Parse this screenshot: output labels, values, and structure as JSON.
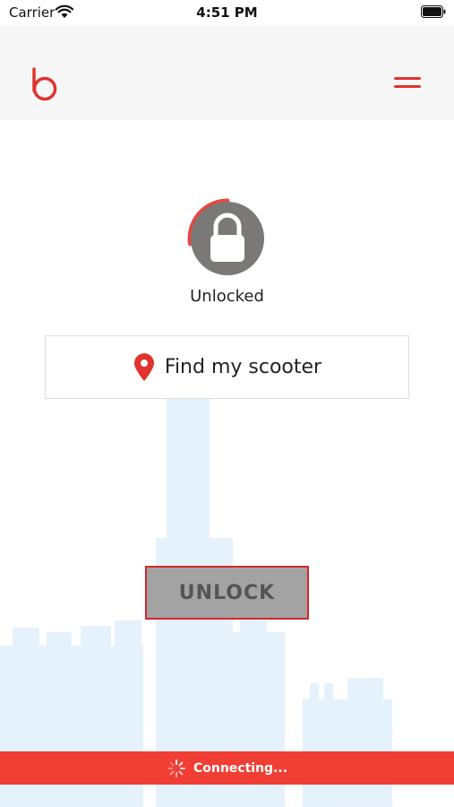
{
  "status_bar": {
    "carrier": "Carrier",
    "time": "4:51 PM",
    "icons": [
      "wifi-icon",
      "battery-icon"
    ]
  },
  "header": {
    "logo": "b",
    "menu_icon": "hamburger-menu-icon"
  },
  "lock": {
    "status_label": "Unlocked",
    "icon": "padlock-icon"
  },
  "find_scooter": {
    "label": "Find my scooter",
    "icon": "map-pin-icon"
  },
  "unlock_button": {
    "label": "UNLOCK"
  },
  "connection": {
    "label": "Connecting...",
    "icon": "spinner-icon"
  },
  "colors": {
    "accent": "#e0332e",
    "banner": "#f03e34",
    "button_gray": "#a3a3a3",
    "lock_circle": "#7b7978"
  }
}
